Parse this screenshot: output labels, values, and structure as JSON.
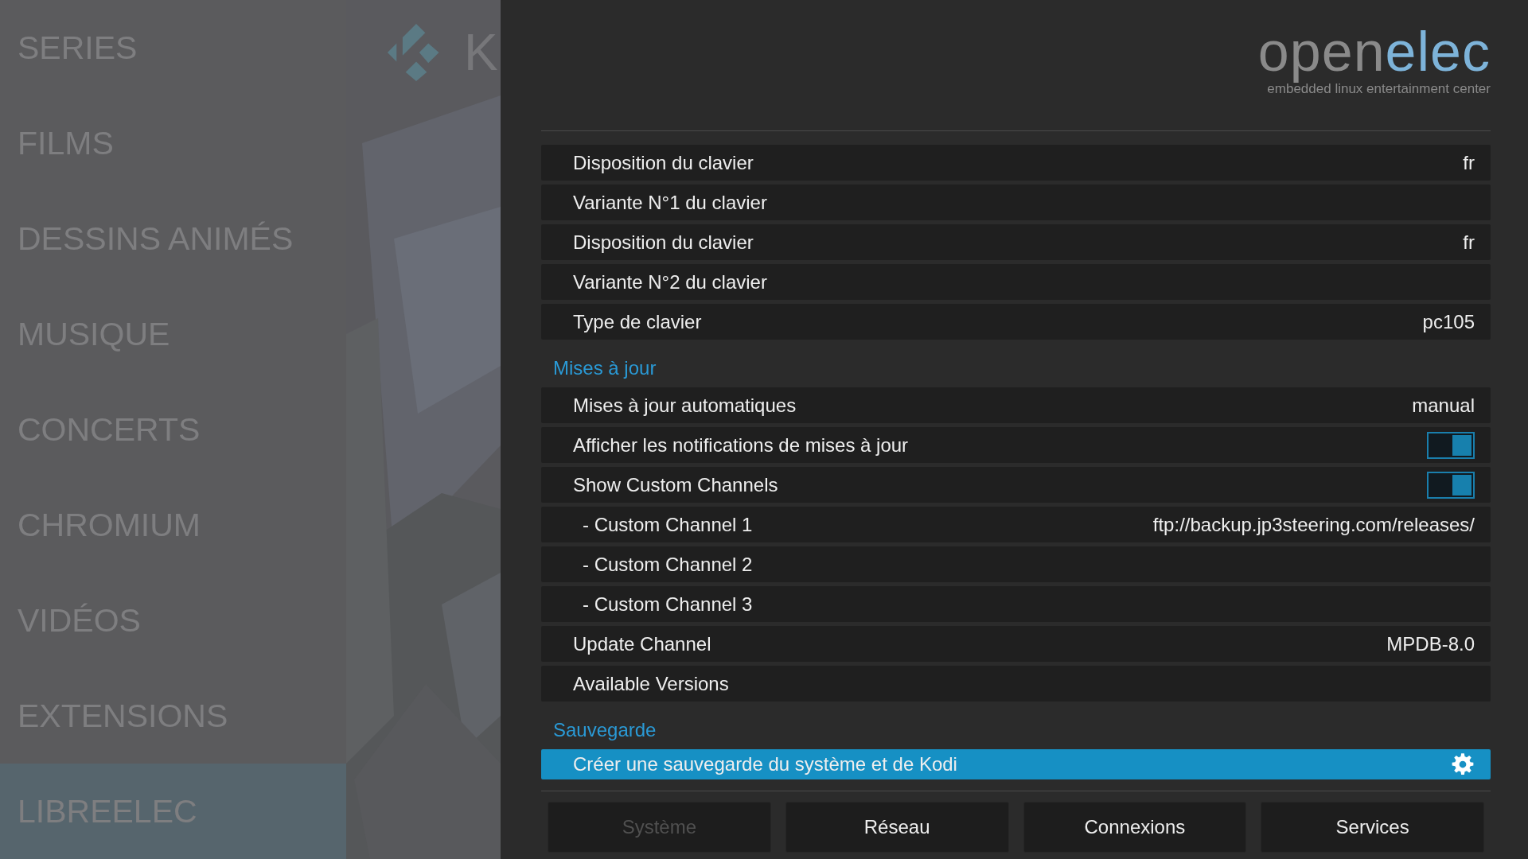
{
  "sidebar": {
    "items": [
      {
        "label": "SERIES",
        "selected": false
      },
      {
        "label": "FILMS",
        "selected": false
      },
      {
        "label": "DESSINS ANIMÉS",
        "selected": false
      },
      {
        "label": "MUSIQUE",
        "selected": false
      },
      {
        "label": "CONCERTS",
        "selected": false
      },
      {
        "label": "CHROMIUM",
        "selected": false
      },
      {
        "label": "VIDÉOS",
        "selected": false
      },
      {
        "label": "EXTENSIONS",
        "selected": false
      },
      {
        "label": "LIBREELEC",
        "selected": true
      }
    ]
  },
  "background": {
    "kind": "picture",
    "logo_text": "K"
  },
  "dialog": {
    "logo": {
      "part_1": "open",
      "part_2": "elec",
      "tagline": "embedded linux entertainment center"
    },
    "rows": [
      {
        "kind": "value",
        "label": "Disposition du clavier",
        "value": "fr",
        "selected": false
      },
      {
        "kind": "value",
        "label": "Variante N°1 du clavier",
        "selected": false
      },
      {
        "kind": "value",
        "label": "Disposition du clavier",
        "value": "fr",
        "selected": false
      },
      {
        "kind": "value",
        "label": "Variante N°2 du clavier",
        "selected": false
      },
      {
        "kind": "value",
        "label": "Type de clavier",
        "value": "pc105",
        "selected": false
      },
      {
        "kind": "heading",
        "label": "Mises à jour"
      },
      {
        "kind": "value",
        "label": "Mises à jour automatiques",
        "value": "manual",
        "selected": false
      },
      {
        "kind": "toggle",
        "label": "Afficher les notifications de mises à jour",
        "on": true,
        "selected": false
      },
      {
        "kind": "toggle",
        "label": "Show Custom Channels",
        "on": true,
        "selected": false
      },
      {
        "kind": "subvalue",
        "label": "- Custom Channel 1",
        "value": "ftp://backup.jp3steering.com/releases/",
        "selected": false
      },
      {
        "kind": "subvalue",
        "label": "- Custom Channel 2",
        "selected": false
      },
      {
        "kind": "subvalue",
        "label": "- Custom Channel 3",
        "selected": false
      },
      {
        "kind": "value",
        "label": "Update Channel",
        "value": "MPDB-8.0",
        "selected": false
      },
      {
        "kind": "value",
        "label": "Available Versions",
        "selected": false
      },
      {
        "kind": "heading",
        "label": "Sauvegarde"
      },
      {
        "kind": "action",
        "label": "Créer une sauvegarde du système et de Kodi",
        "selected": true
      }
    ],
    "buttons": [
      {
        "label": "Système",
        "disabled": true
      },
      {
        "label": "Réseau",
        "disabled": false
      },
      {
        "label": "Connexions",
        "disabled": false
      },
      {
        "label": "Services",
        "disabled": false
      }
    ]
  }
}
